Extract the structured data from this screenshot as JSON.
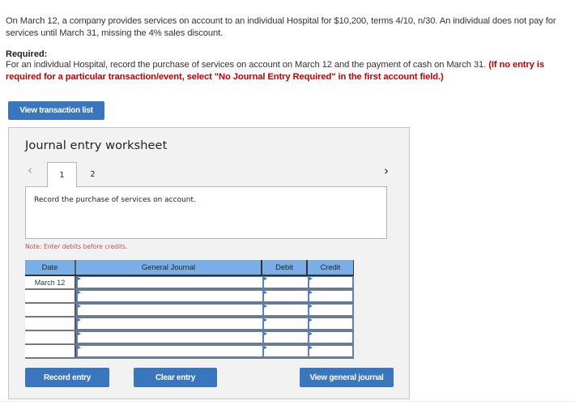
{
  "problem": {
    "text": "On March 12, a company provides services on account to an individual Hospital for $10,200, terms 4/10, n/30. An individual does not pay for services until March 31, missing the 4% sales discount."
  },
  "required": {
    "label": "Required:",
    "text": "For an individual Hospital, record the purchase of services on account on March 12 and the payment of cash on March 31. ",
    "instruction": "(If no entry is required for a particular transaction/event, select \"No Journal Entry Required\" in the first account field.)"
  },
  "buttons": {
    "view_transaction_list": "View transaction list",
    "record_entry": "Record entry",
    "clear_entry": "Clear entry",
    "view_general_journal": "View general journal"
  },
  "worksheet": {
    "title": "Journal entry worksheet",
    "prev_icon": "‹",
    "next_icon": "›",
    "tabs": [
      {
        "label": "1",
        "active": true
      },
      {
        "label": "2",
        "active": false
      }
    ],
    "description": "Record the purchase of services on account.",
    "note": "Note: Enter debits before credits."
  },
  "journal": {
    "columns": [
      "Date",
      "General Journal",
      "Debit",
      "Credit"
    ],
    "rows": [
      {
        "date": "March 12",
        "account": "",
        "debit": "",
        "credit": ""
      },
      {
        "date": "",
        "account": "",
        "debit": "",
        "credit": ""
      },
      {
        "date": "",
        "account": "",
        "debit": "",
        "credit": ""
      },
      {
        "date": "",
        "account": "",
        "debit": "",
        "credit": ""
      },
      {
        "date": "",
        "account": "",
        "debit": "",
        "credit": ""
      },
      {
        "date": "",
        "account": "",
        "debit": "",
        "credit": ""
      }
    ]
  },
  "colors": {
    "button": "#3a76bd",
    "table_header": "#7aaee6",
    "instruction_red": "#c00000",
    "note_red": "#c0504d"
  }
}
